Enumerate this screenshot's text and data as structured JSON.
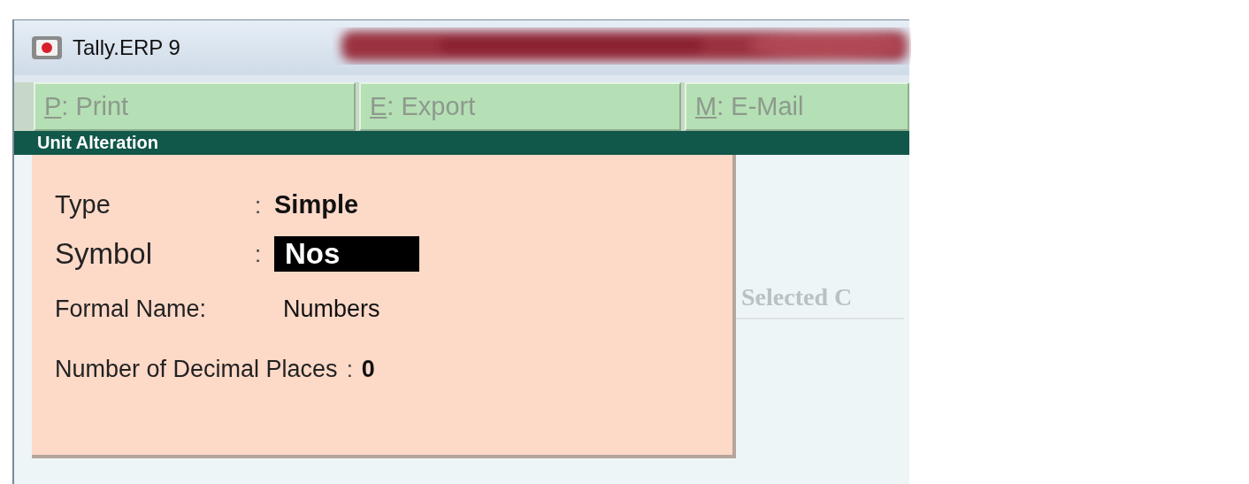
{
  "window": {
    "title": "Tally.ERP 9"
  },
  "buttons": [
    {
      "key": "P",
      "label": ": Print"
    },
    {
      "key": "E",
      "label": ": Export"
    },
    {
      "key": "M",
      "label": ": E-Mail"
    }
  ],
  "panel": {
    "title": "Unit Alteration",
    "fields": [
      {
        "label": "Type",
        "separator": ":",
        "value": "Simple",
        "selected": false
      },
      {
        "label": "Symbol",
        "separator": ":",
        "value": "Nos",
        "selected": true
      },
      {
        "label": "Formal Name:",
        "value": "Numbers",
        "selected": false
      },
      {
        "label": "Number of Decimal Places",
        "separator": ":",
        "value": "0",
        "selected": false
      }
    ]
  },
  "background_text": "Selected C"
}
